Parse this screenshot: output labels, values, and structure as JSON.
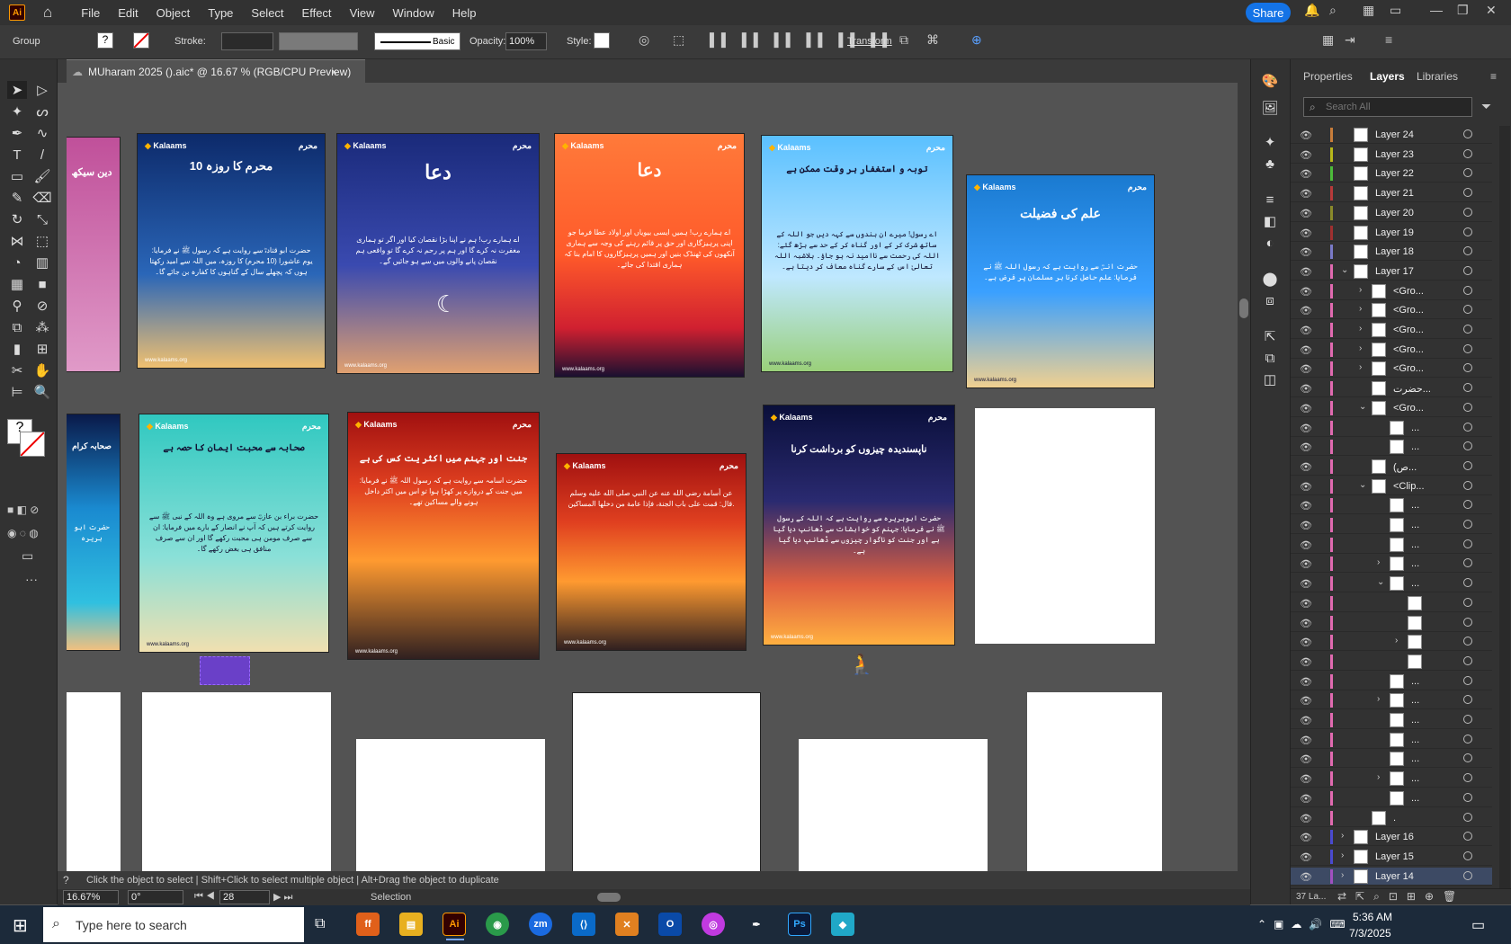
{
  "app": {
    "logo": "Ai",
    "home_icon": "home-icon"
  },
  "menu": [
    "File",
    "Edit",
    "Object",
    "Type",
    "Select",
    "Effect",
    "View",
    "Window",
    "Help"
  ],
  "topright": {
    "share": "Share"
  },
  "control": {
    "selection": "Group",
    "stroke_label": "Stroke:",
    "stroke_style": "Basic",
    "opacity_label": "Opacity:",
    "opacity_value": "100%",
    "style_label": "Style:",
    "transform_label": "Transform"
  },
  "document": {
    "tab_title": "MUharam 2025 ().aic* @ 16.67 % (RGB/CPU Preview)",
    "close": "×"
  },
  "cards": [
    {
      "brand": "Kalaams",
      "title": "",
      "text": "دین سیکھ",
      "footer": ""
    },
    {
      "brand": "Kalaams",
      "title": "10 محرم کا روزہ",
      "text": "حضرت ابو قتادہؓ سے روایت ہے کہ رسول ﷺ نے فرمایا: یوم عاشورا (10 محرم) کا روزہ، میں اللہ سے امید رکھتا ہوں کہ پچھلے سال کے گناہوں کا کفارہ بن جائے گا۔",
      "footer": "www.kalaams.org"
    },
    {
      "brand": "Kalaams",
      "title": "دعا",
      "text": "اے ہمارے رب! ہم نے اپنا بڑا نقصان کیا اور اگر تو ہماری مغفرت نہ کرے گا اور ہم پر رحم نہ کرے گا تو واقعی ہم نقصان پانے والوں میں سے ہو جائیں گے۔",
      "footer": "www.kalaams.org"
    },
    {
      "brand": "Kalaams",
      "title": "دعا",
      "text": "اے ہمارے رب! ہمیں ایسی بیویاں اور اولاد عطا فرما جو اپنی پرہیزگاری اور حق پر قائم رہنے کی وجہ سے ہماری آنکھوں کی ٹھنڈک بنیں اور ہمیں پرہیزگاروں کا امام بنا کہ ہماری اقتدا کی جائے۔",
      "footer": "www.kalaams.org"
    },
    {
      "brand": "Kalaams",
      "title": "توبہ و استغفار ہر وقت ممکن ہے",
      "text": "اے رسول! میرے ان بندوں سے کہہ دیں جو اللہ کے ساتھ شرک کر کے اور گناہ کر کے حد سے بڑھ گئے: اللہ کی رحمت سے ناامید نہ ہو جاؤ۔ بلاشبہ اللہ تعالیٰ اس کے سارے گناہ معاف کر دیتا ہے۔",
      "footer": "www.kalaams.org"
    },
    {
      "brand": "Kalaams",
      "title": "علم کی فضیلت",
      "text": "حضرت انسؓ سے روایت ہے کہ رسول اللہ ﷺ نے فرمایا: علم حاصل کرنا ہر مسلمان پر فرض ہے۔",
      "footer": "www.kalaams.org"
    },
    {
      "brand": "Kalaams",
      "title": "صحابہ کرام",
      "text": "حضرت ابو ہریرہ",
      "footer": ""
    },
    {
      "brand": "Kalaams",
      "title": "صحابہ سے محبت ایمان کا حصہ ہے",
      "text": "حضرت براء بن عازبؓ سے مروی ہے وہ اللہ کے نبی ﷺ سے روایت کرتے ہیں کہ آپ نے انصار کے بارے میں فرمایا: ان سے صرف مومن ہی محبت رکھے گا اور ان سے صرف منافق ہی بغض رکھے گا۔",
      "footer": "www.kalaams.org"
    },
    {
      "brand": "Kalaams",
      "title": "جنت اور جہنم میں اکثر یت کس کی ہے",
      "text": "حضرت اسامہ سے روایت ہے کہ رسول اللہ ﷺ نے فرمایا: میں جنت کے دروازے پر کھڑا ہوا تو اس میں اکثر داخل ہونے والے مساکین تھے۔",
      "footer": "www.kalaams.org"
    },
    {
      "brand": "Kalaams",
      "title": "",
      "text": "عن أسامة رضي الله عنه عن النبي صلى الله عليه وسلم قال: قمت على باب الجنة، فإذا عامة من دخلها المساكين.",
      "footer": "www.kalaams.org"
    },
    {
      "brand": "Kalaams",
      "title": "ناپسندیدہ چیزوں کو برداشت کرنا",
      "text": "حضرت ابوہریرہ سے روایت ہے کہ اللہ کے رسول ﷺ نے فرمایا: جہنم کو خواہشات سے ڈھانپ دیا گیا ہے اور جنت کو ناگوار چیزوں سے ڈھانپ دیا گیا ہے۔",
      "footer": "www.kalaams.org"
    }
  ],
  "panel": {
    "tabs": [
      "Properties",
      "Layers",
      "Libraries"
    ],
    "search_placeholder": "Search All",
    "footer_count": "37 La..."
  },
  "layers": [
    {
      "name": "Layer 24",
      "color": "#c87d3a",
      "indent": 0,
      "twirl": ""
    },
    {
      "name": "Layer 23",
      "color": "#b8b81a",
      "indent": 0,
      "twirl": ""
    },
    {
      "name": "Layer 22",
      "color": "#4dbb3a",
      "indent": 0,
      "twirl": ""
    },
    {
      "name": "Layer 21",
      "color": "#b83a3a",
      "indent": 0,
      "twirl": ""
    },
    {
      "name": "Layer 20",
      "color": "#8a8a2a",
      "indent": 0,
      "twirl": ""
    },
    {
      "name": "Layer 19",
      "color": "#a03030",
      "indent": 0,
      "twirl": ""
    },
    {
      "name": "Layer 18",
      "color": "#7a7ac8",
      "indent": 0,
      "twirl": ""
    },
    {
      "name": "Layer 17",
      "color": "#e06ab0",
      "indent": 0,
      "twirl": "⌄"
    },
    {
      "name": "<Gro...",
      "color": "#e06ab0",
      "indent": 1,
      "twirl": "›"
    },
    {
      "name": "<Gro...",
      "color": "#e06ab0",
      "indent": 1,
      "twirl": "›"
    },
    {
      "name": "<Gro...",
      "color": "#e06ab0",
      "indent": 1,
      "twirl": "›"
    },
    {
      "name": "<Gro...",
      "color": "#e06ab0",
      "indent": 1,
      "twirl": "›"
    },
    {
      "name": "<Gro...",
      "color": "#e06ab0",
      "indent": 1,
      "twirl": "›"
    },
    {
      "name": "حضرت...",
      "color": "#e06ab0",
      "indent": 1,
      "twirl": ""
    },
    {
      "name": "<Gro...",
      "color": "#e06ab0",
      "indent": 1,
      "twirl": "⌄"
    },
    {
      "name": "...",
      "color": "#e06ab0",
      "indent": 2,
      "twirl": ""
    },
    {
      "name": "...",
      "color": "#e06ab0",
      "indent": 2,
      "twirl": ""
    },
    {
      "name": "(ص...",
      "color": "#e06ab0",
      "indent": 1,
      "twirl": ""
    },
    {
      "name": "<Clip...",
      "color": "#e06ab0",
      "indent": 1,
      "twirl": "⌄"
    },
    {
      "name": "...",
      "color": "#e06ab0",
      "indent": 2,
      "twirl": ""
    },
    {
      "name": "...",
      "color": "#e06ab0",
      "indent": 2,
      "twirl": ""
    },
    {
      "name": "...",
      "color": "#e06ab0",
      "indent": 2,
      "twirl": ""
    },
    {
      "name": "...",
      "color": "#e06ab0",
      "indent": 2,
      "twirl": "›"
    },
    {
      "name": "...",
      "color": "#e06ab0",
      "indent": 2,
      "twirl": "⌄"
    },
    {
      "name": "",
      "color": "#e06ab0",
      "indent": 3,
      "twirl": ""
    },
    {
      "name": "",
      "color": "#e06ab0",
      "indent": 3,
      "twirl": ""
    },
    {
      "name": "",
      "color": "#e06ab0",
      "indent": 3,
      "twirl": "›"
    },
    {
      "name": "",
      "color": "#e06ab0",
      "indent": 3,
      "twirl": ""
    },
    {
      "name": "...",
      "color": "#e06ab0",
      "indent": 2,
      "twirl": ""
    },
    {
      "name": "...",
      "color": "#e06ab0",
      "indent": 2,
      "twirl": "›"
    },
    {
      "name": "...",
      "color": "#e06ab0",
      "indent": 2,
      "twirl": ""
    },
    {
      "name": "...",
      "color": "#e06ab0",
      "indent": 2,
      "twirl": ""
    },
    {
      "name": "...",
      "color": "#e06ab0",
      "indent": 2,
      "twirl": ""
    },
    {
      "name": "...",
      "color": "#e06ab0",
      "indent": 2,
      "twirl": "›"
    },
    {
      "name": "...",
      "color": "#e06ab0",
      "indent": 2,
      "twirl": ""
    },
    {
      "name": ".",
      "color": "#e06ab0",
      "indent": 1,
      "twirl": ""
    },
    {
      "name": "Layer 16",
      "color": "#4a4ad0",
      "indent": 0,
      "twirl": "›"
    },
    {
      "name": "Layer 15",
      "color": "#4a4ad0",
      "indent": 0,
      "twirl": "›"
    },
    {
      "name": "Layer 14",
      "color": "#a050c0",
      "indent": 0,
      "twirl": "›"
    }
  ],
  "status": {
    "hint": "Click the object to select  |  Shift+Click to select multiple object  |  Alt+Drag the object to duplicate",
    "zoom": "16.67%",
    "angle": "0°",
    "artboard": "28",
    "tool": "Selection"
  },
  "taskbar": {
    "search_placeholder": "Type here to search",
    "time": "5:36 AM",
    "date": "7/3/2025"
  }
}
